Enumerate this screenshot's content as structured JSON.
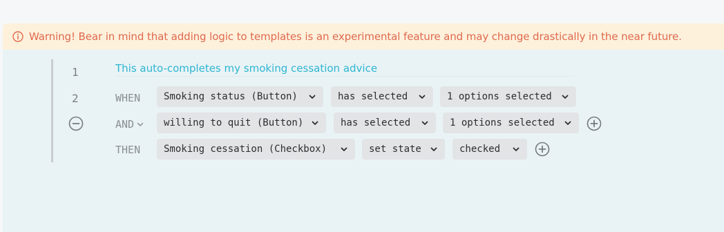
{
  "warning": {
    "icon": "info-circle-icon",
    "text": "Warning! Bear in mind that adding logic to templates is an experimental feature and may change drastically in the near future."
  },
  "logic": {
    "line1": "1",
    "line2": "2",
    "description": "This auto-completes my smoking cessation advice",
    "when": {
      "keyword": "WHEN",
      "field": "Smoking status (Button)",
      "operator": "has selected",
      "value": "1 options selected"
    },
    "and": {
      "keyword": "AND",
      "field": "willing to quit (Button)",
      "operator": "has selected",
      "value": "1 options selected"
    },
    "then": {
      "keyword": "THEN",
      "target": "Smoking cessation (Checkbox)",
      "action": "set state",
      "value": "checked"
    }
  },
  "colors": {
    "warning_text": "#e0694e",
    "warning_bg": "#fdf1dc",
    "panel_bg": "#e9f3f6",
    "description": "#2eb6d0"
  }
}
